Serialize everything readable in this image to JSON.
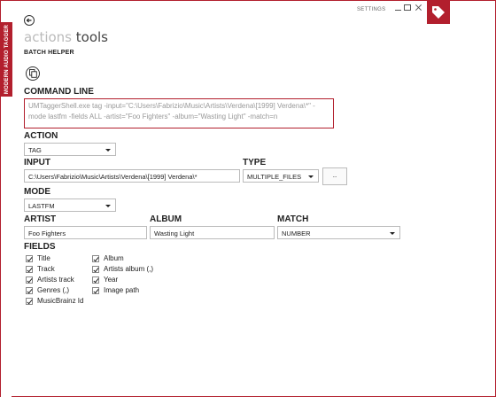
{
  "window": {
    "app_side_label": "MODERN AUDIO TAGGER",
    "settings_label": "SETTINGS"
  },
  "header": {
    "breadcrumb_dim": "actions",
    "breadcrumb_current": "tools",
    "section_title": "BATCH HELPER"
  },
  "command_line": {
    "label": "COMMAND LINE",
    "value": "UMTaggerShell.exe tag -input=\"C:\\Users\\Fabrizio\\Music\\Artists\\Verdena\\[1999] Verdena\\*\" -mode lastfm -fields ALL -artist=\"Foo Fighters\" -album=\"Wasting Light\" -match=n"
  },
  "action": {
    "label": "ACTION",
    "value": "TAG"
  },
  "input": {
    "label": "INPUT",
    "value": "C:\\Users\\Fabrizio\\Music\\Artists\\Verdena\\[1999] Verdena\\*"
  },
  "type": {
    "label": "TYPE",
    "value": "MULTIPLE_FILES",
    "browse_label": ".."
  },
  "mode": {
    "label": "MODE",
    "value": "LASTFM"
  },
  "artist": {
    "label": "ARTIST",
    "value": "Foo Fighters"
  },
  "album": {
    "label": "ALBUM",
    "value": "Wasting Light"
  },
  "match": {
    "label": "MATCH",
    "value": "NUMBER"
  },
  "fields": {
    "label": "FIELDS",
    "items": [
      {
        "label": "Title",
        "checked": true
      },
      {
        "label": "Track",
        "checked": true
      },
      {
        "label": "Artists track",
        "checked": true
      },
      {
        "label": "Genres (,)",
        "checked": true
      },
      {
        "label": "MusicBrainz Id",
        "checked": true
      },
      {
        "label": "Album",
        "checked": true
      },
      {
        "label": "Artists album (,)",
        "checked": true
      },
      {
        "label": "Year",
        "checked": true
      },
      {
        "label": "Image path",
        "checked": true
      }
    ]
  },
  "colors": {
    "accent": "#b21f2d"
  }
}
